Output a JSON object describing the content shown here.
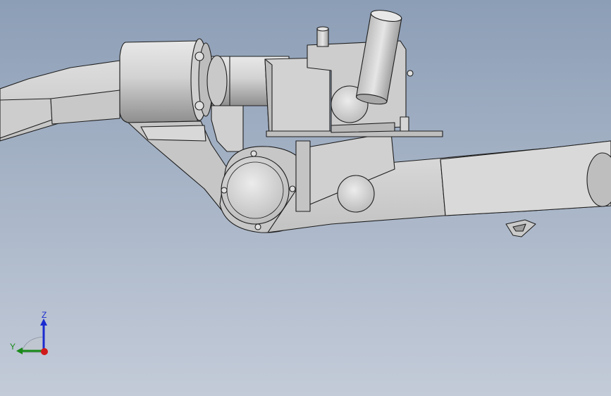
{
  "triad": {
    "z_label": "Z",
    "y_label": "Y"
  },
  "colors": {
    "background_top": "#8c9eb6",
    "background_bottom": "#c3cbd8",
    "part_fill": "#d4d4d4",
    "part_shadow": "#9a9a9a",
    "edge": "#1e1e1e",
    "z_axis": "#1a2bd0",
    "y_axis": "#1a8a1a",
    "x_axis": "#d01a1a"
  }
}
